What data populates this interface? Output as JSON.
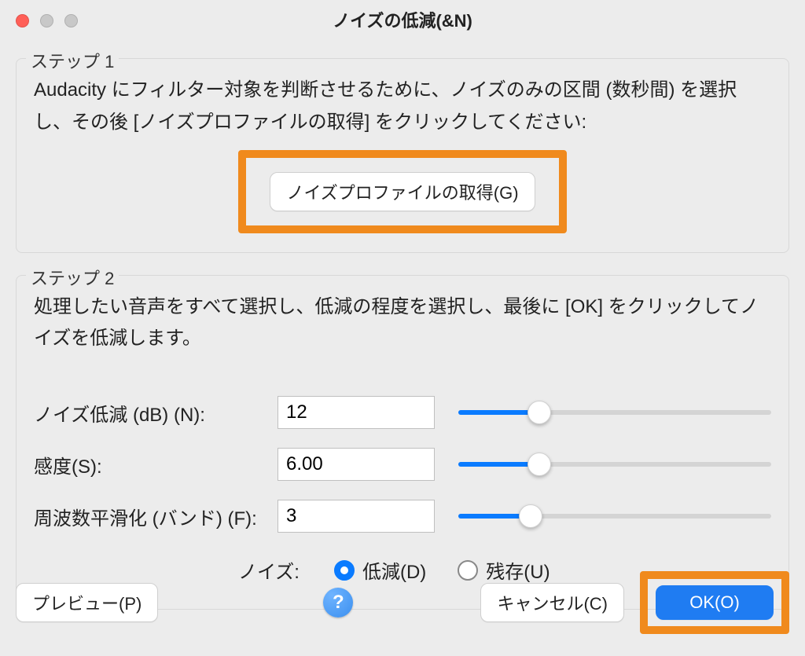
{
  "window": {
    "title": "ノイズの低減(&N)"
  },
  "step1": {
    "legend": "ステップ 1",
    "instruction": "Audacity にフィルター対象を判断させるために、ノイズのみの区間 (数秒間) を選択し、その後 [ノイズプロファイルの取得] をクリックしてください:",
    "profile_button": "ノイズプロファイルの取得(G)"
  },
  "step2": {
    "legend": "ステップ 2",
    "instruction": "処理したい音声をすべて選択し、低減の程度を選択し、最後に [OK] をクリックしてノイズを低減します。",
    "noise_reduction": {
      "label": "ノイズ低減 (dB) (N):",
      "value": "12",
      "fraction": 0.26
    },
    "sensitivity": {
      "label": "感度(S):",
      "value": "6.00",
      "fraction": 0.26
    },
    "smoothing": {
      "label": "周波数平滑化 (バンド) (F):",
      "value": "3",
      "fraction": 0.23
    },
    "noise_radio": {
      "label": "ノイズ:",
      "reduce": "低減(D)",
      "residue": "残存(U)",
      "selected": "reduce"
    }
  },
  "footer": {
    "preview": "プレビュー(P)",
    "help": "?",
    "cancel": "キャンセル(C)",
    "ok": "OK(O)"
  },
  "colors": {
    "accent": "#0a7bff",
    "highlight": "#f08a1d"
  }
}
